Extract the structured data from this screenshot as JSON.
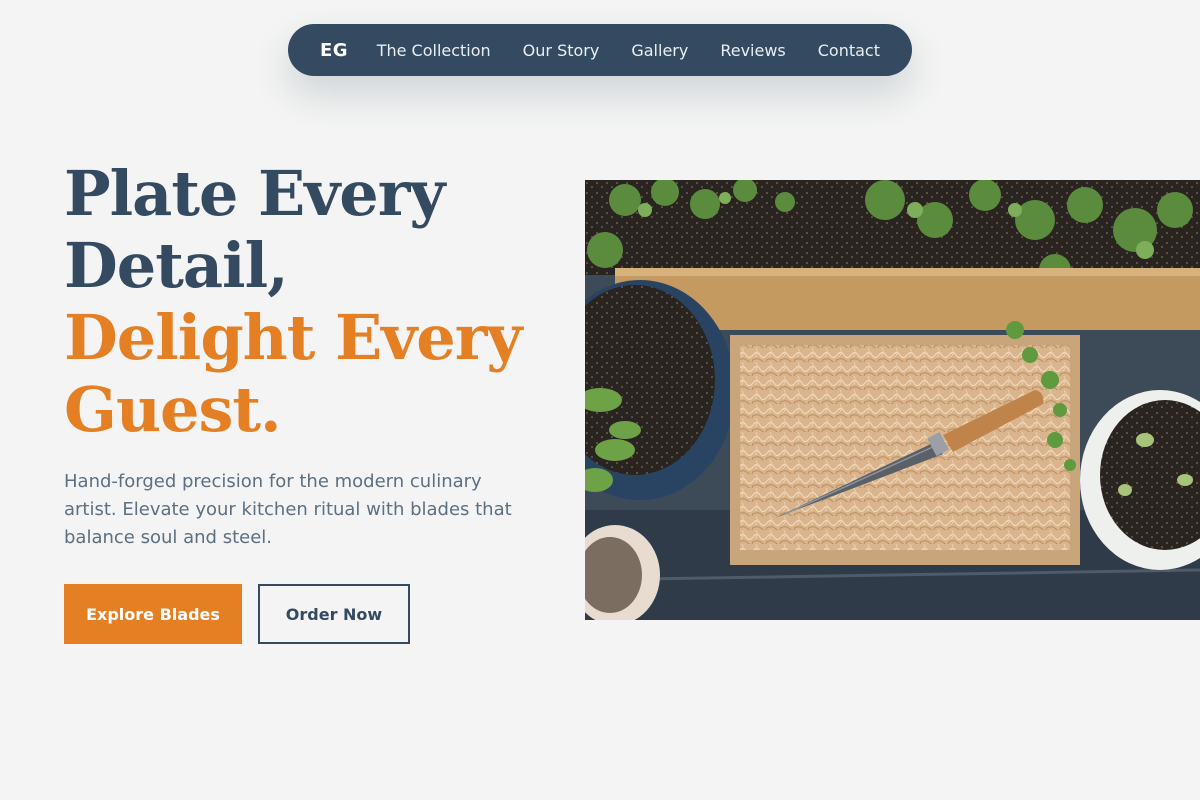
{
  "nav": {
    "logo": "EG",
    "links": [
      "The Collection",
      "Our Story",
      "Gallery",
      "Reviews",
      "Contact"
    ]
  },
  "hero": {
    "headline_line1": "Plate Every",
    "headline_line2": "Detail,",
    "headline_accent1": "Delight Every",
    "headline_accent2": "Guest.",
    "subtitle": "Hand-forged precision for the modern culinary artist. Elevate your kitchen ritual with blades that balance soul and steel.",
    "primary_button": "Explore Blades",
    "secondary_button": "Order Now"
  },
  "colors": {
    "navy": "#344a60",
    "accent": "#e57f24",
    "background": "#f3f4f3"
  }
}
